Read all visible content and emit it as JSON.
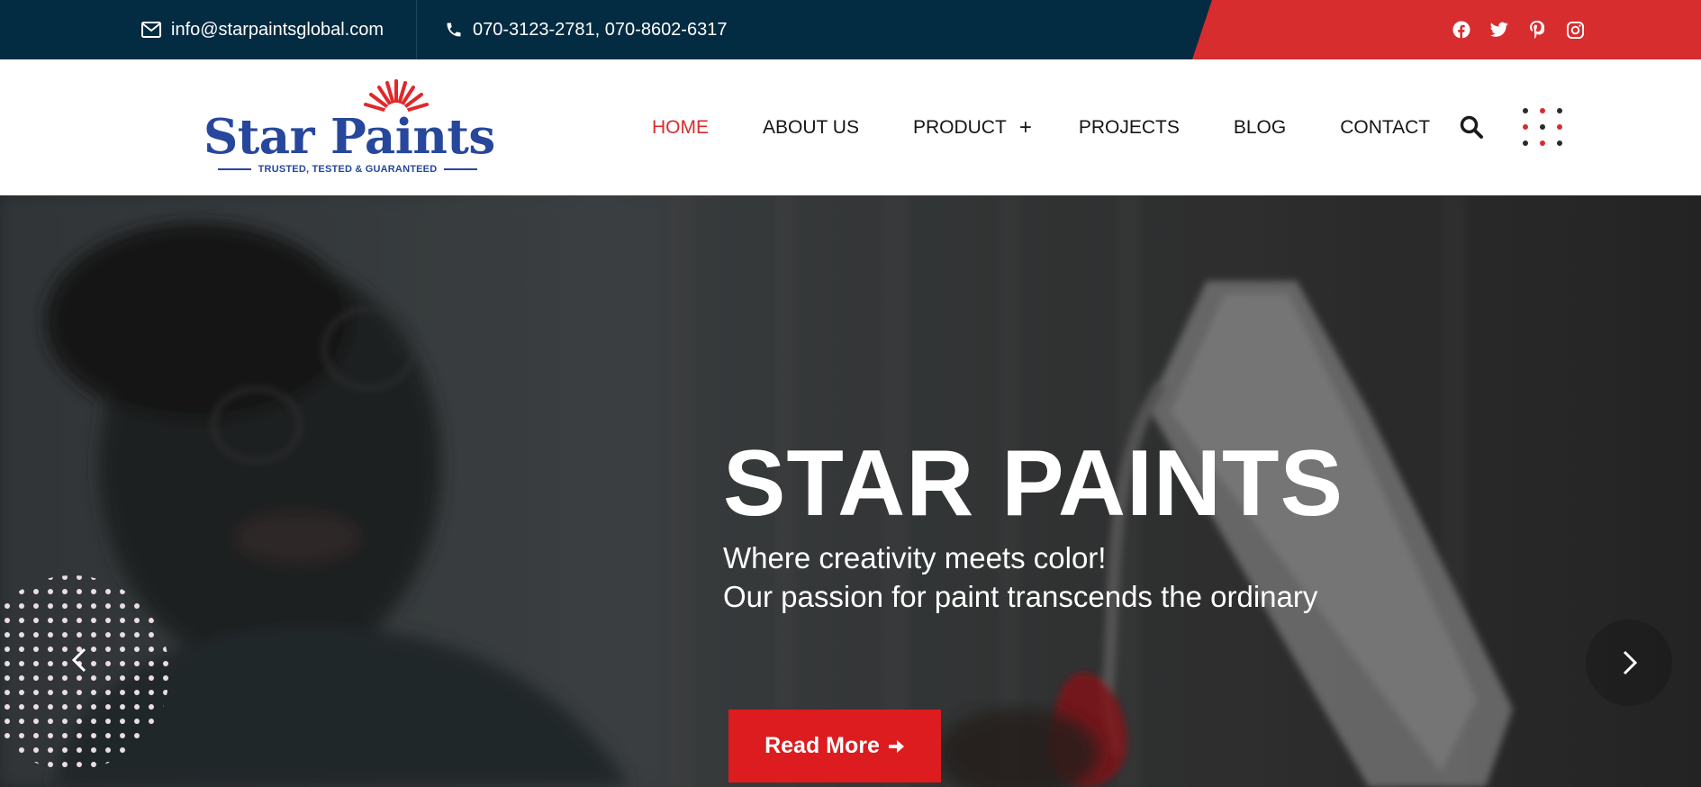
{
  "topbar": {
    "email": "info@starpaintsglobal.com",
    "phone": "070-3123-2781, 070-8602-6317",
    "socials": [
      {
        "icon": "facebook-icon"
      },
      {
        "icon": "twitter-icon"
      },
      {
        "icon": "pinterest-icon"
      },
      {
        "icon": "instagram-icon"
      }
    ]
  },
  "logo": {
    "wordmark": "Star Paints",
    "tagline": "TRUSTED, TESTED & GUARANTEED"
  },
  "nav": {
    "items": [
      {
        "label": "HOME",
        "active": true
      },
      {
        "label": "ABOUT US"
      },
      {
        "label": "PRODUCT",
        "has_submenu": true,
        "submenu_glyph": "+"
      },
      {
        "label": "PROJECTS"
      },
      {
        "label": "BLOG"
      },
      {
        "label": "CONTACT"
      }
    ],
    "search_icon": "search-icon",
    "menu_icon": "grid-dots-icon"
  },
  "hero": {
    "title": "STAR PAINTS",
    "subtitle_line1": "Where creativity meets color!",
    "subtitle_line2": "Our passion for paint transcends the ordinary",
    "cta_label": "Read More",
    "cta_icon": "arrow-right-icon",
    "prev_icon": "chevron-left-icon",
    "next_icon": "chevron-right-icon"
  },
  "colors": {
    "navy": "#032b41",
    "accent_red": "#d72d2f",
    "button_red": "#dc1c1f",
    "logo_blue": "#26479b",
    "text_dark": "#151515"
  }
}
